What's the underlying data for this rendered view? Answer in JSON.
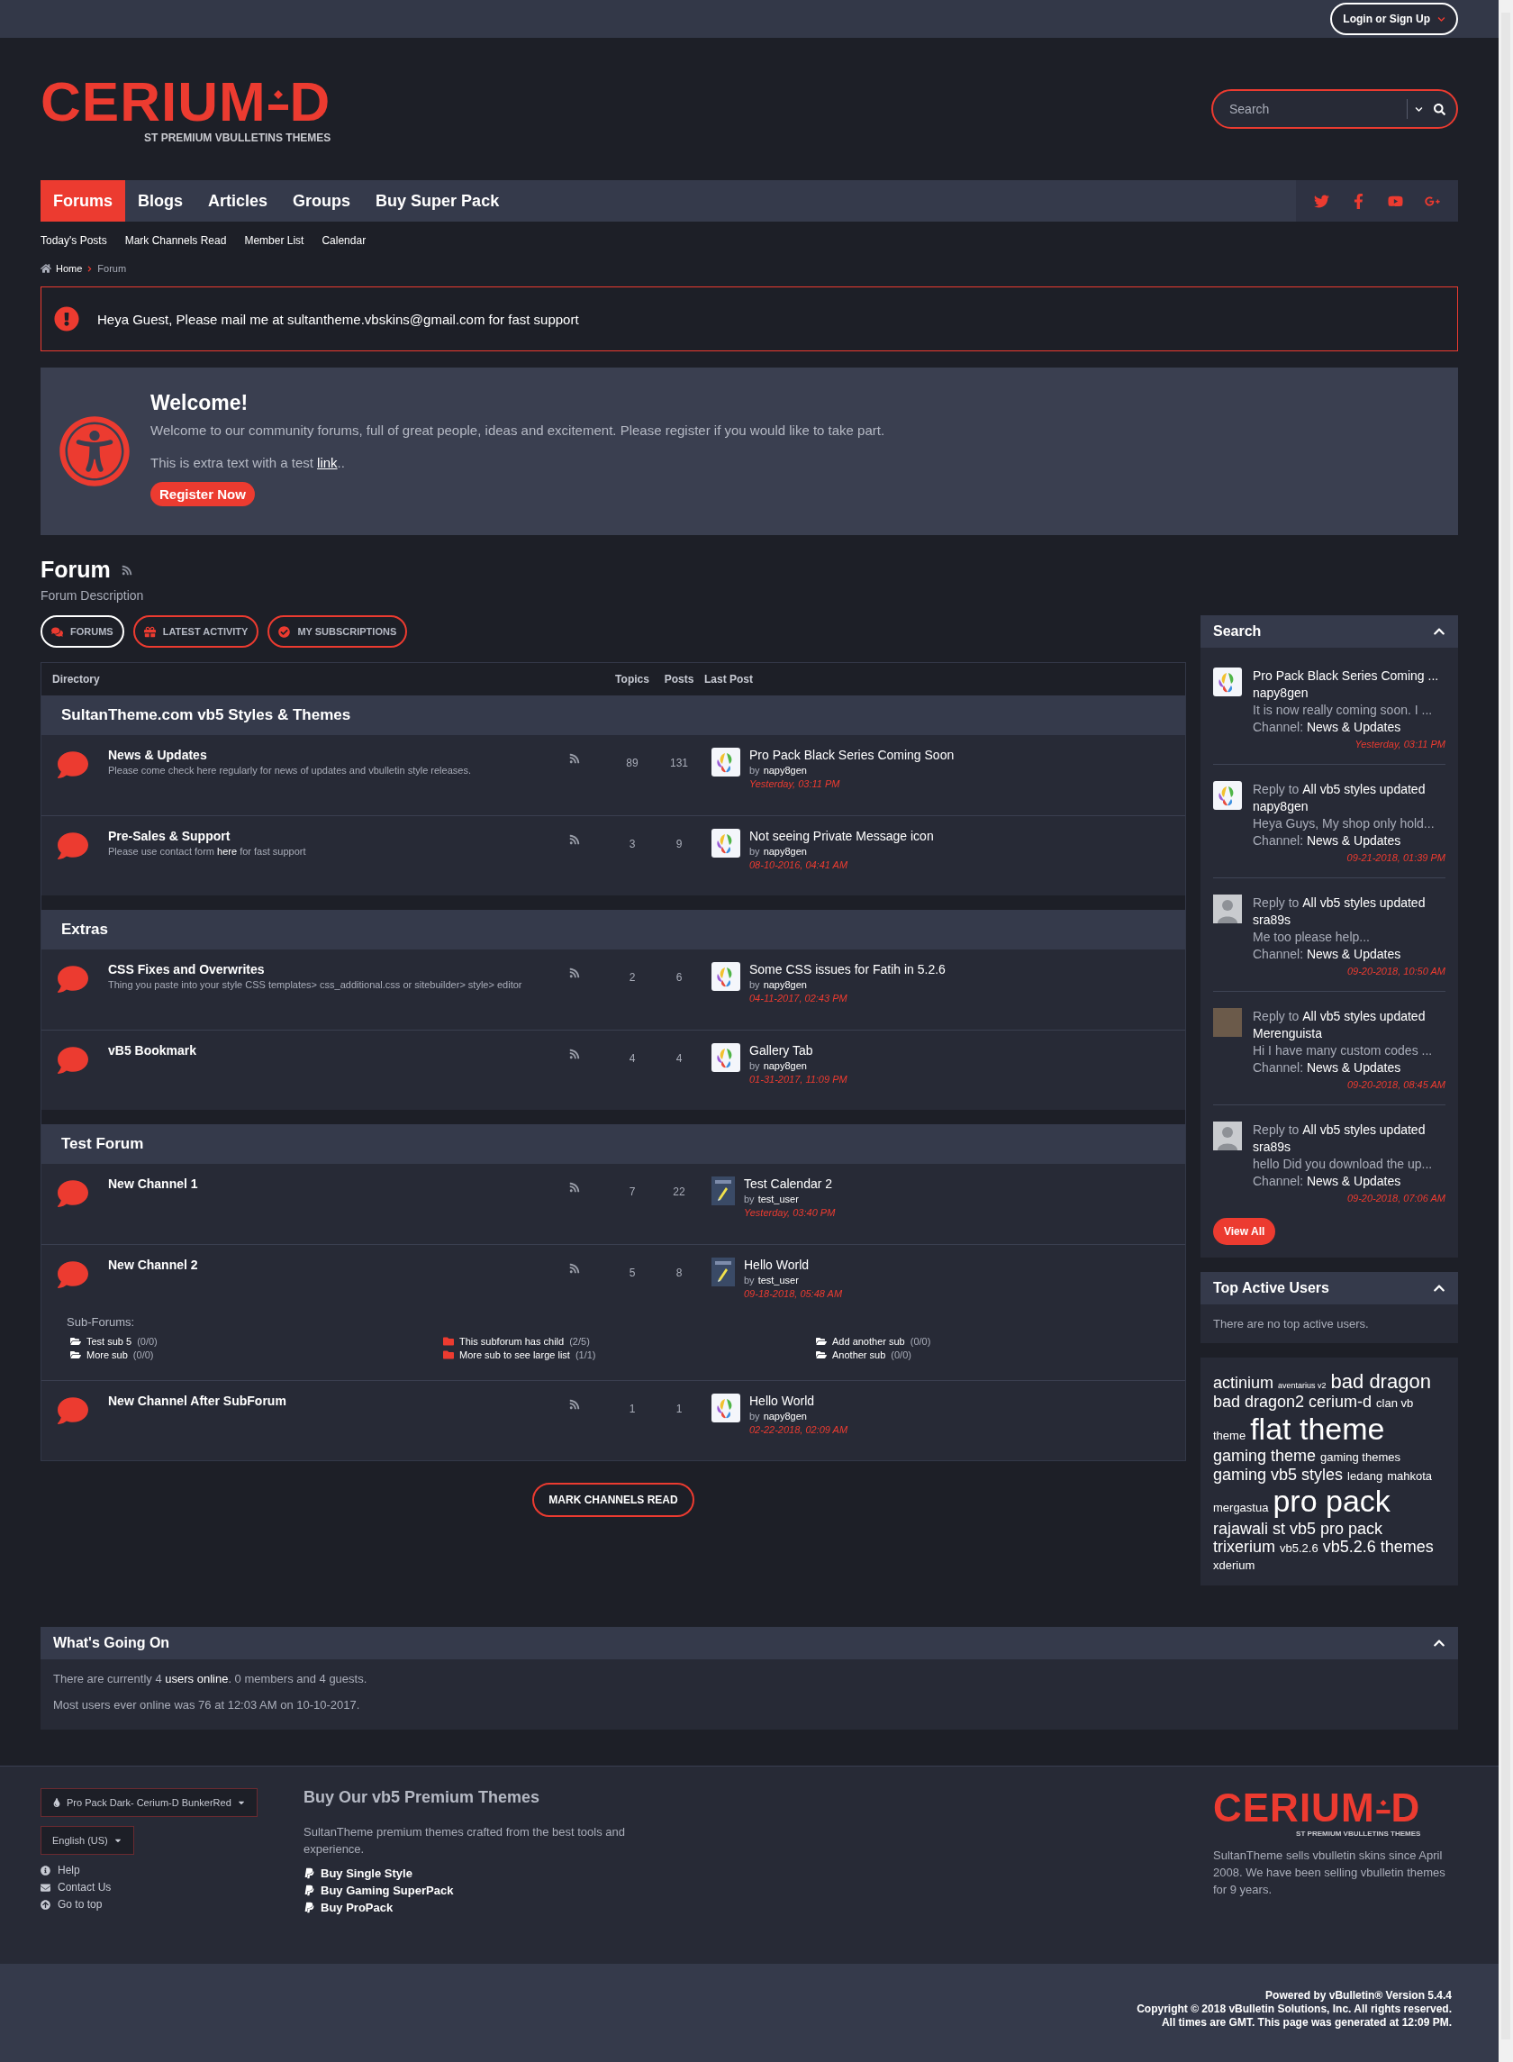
{
  "top_bar": {
    "login": "Login or Sign Up"
  },
  "logo": {
    "left": "CERIUM",
    "right": "D",
    "tagline": "ST PREMIUM VBULLETINS THEMES"
  },
  "footer_logo": {
    "left": "CERIUM",
    "right": "D",
    "tagline": "ST PREMIUM VBULLETINS THEMES"
  },
  "search": {
    "placeholder": "Search"
  },
  "nav": {
    "items": [
      {
        "label": "Forums",
        "selected": true
      },
      {
        "label": "Blogs",
        "selected": false
      },
      {
        "label": "Articles",
        "selected": false
      },
      {
        "label": "Groups",
        "selected": false
      },
      {
        "label": "Buy Super Pack",
        "selected": false
      }
    ]
  },
  "subnav": [
    "Today's Posts",
    "Mark Channels Read",
    "Member List",
    "Calendar"
  ],
  "breadcrumb": [
    "Home",
    "Forum"
  ],
  "alert": {
    "text": "Heya Guest, Please mail me at sultantheme.vbskins@gmail.com for fast support"
  },
  "welcome": {
    "title": "Welcome!",
    "text": "Welcome to our community forums, full of great people, ideas and excitement. Please register if you would like to take part.",
    "extra_before": "This is extra text with a test ",
    "extra_link": "link",
    "extra_after": "..",
    "button": "Register Now"
  },
  "forum": {
    "title": "Forum",
    "description": "Forum Description"
  },
  "forum_tabs": [
    {
      "label": "FORUMS",
      "selected": true,
      "kind": "comments"
    },
    {
      "label": "LATEST ACTIVITY",
      "selected": false,
      "kind": "gift"
    },
    {
      "label": "MY SUBSCRIPTIONS",
      "selected": false,
      "kind": "check"
    }
  ],
  "table": {
    "columns": [
      "Directory",
      "Topics",
      "Posts",
      "Last Post"
    ],
    "sections": [
      {
        "title": "SultanTheme.com vb5 Styles & Themes",
        "forums": [
          {
            "name": "News & Updates",
            "description": "Please come check here regularly for news of updates and vbulletin style releases.",
            "topics": "89",
            "posts": "131",
            "last_post": {
              "kind": "logo",
              "title": "Pro Pack Black Series Coming Soon",
              "by": "by",
              "user": "napy8gen",
              "time": "Yesterday, 03:11 PM"
            }
          },
          {
            "name": "Pre-Sales & Support",
            "description": "Please use contact form ",
            "description_link": "here",
            "description_after": " for fast support",
            "topics": "3",
            "posts": "9",
            "last_post": {
              "kind": "logo",
              "title": "Not seeing Private Message icon",
              "by": "by",
              "user": "napy8gen",
              "time": "08-10-2016, 04:41 AM"
            }
          }
        ]
      },
      {
        "title": "Extras",
        "forums": [
          {
            "name": "CSS Fixes and Overwrites",
            "description": "Thing you paste into your style CSS templates> css_additional.css or sitebuilder> style> editor",
            "topics": "2",
            "posts": "6",
            "last_post": {
              "kind": "logo",
              "title": "Some CSS issues for Fatih in 5.2.6",
              "by": "by",
              "user": "napy8gen",
              "time": "04-11-2017, 02:43 PM"
            }
          },
          {
            "name": "vB5 Bookmark",
            "topics": "4",
            "posts": "4",
            "last_post": {
              "kind": "logo",
              "title": "Gallery Tab",
              "by": "by",
              "user": "napy8gen",
              "time": "01-31-2017, 11:09 PM"
            }
          }
        ]
      },
      {
        "title": "Test Forum",
        "forums": [
          {
            "name": "New Channel 1",
            "topics": "7",
            "posts": "22",
            "last_post": {
              "kind": "calendar",
              "title": "Test Calendar 2",
              "by": "by",
              "user": "test_user",
              "time": "Yesterday, 03:40 PM"
            }
          },
          {
            "name": "New Channel 2",
            "topics": "5",
            "posts": "8",
            "last_post": {
              "kind": "calendar",
              "title": "Hello World",
              "by": "by",
              "user": "test_user",
              "time": "09-18-2018, 05:48 AM"
            },
            "subforums": {
              "label": "Sub-Forums:",
              "items": [
                {
                  "name": "Test sub 5",
                  "count": "(0/0)",
                  "kind": "open"
                },
                {
                  "name": "More sub",
                  "count": "(0/0)",
                  "kind": "open"
                },
                {
                  "name": "This subforum has child",
                  "count": "(2/5)",
                  "kind": "closed"
                },
                {
                  "name": "More sub to see large list",
                  "count": "(1/1)",
                  "kind": "closed"
                },
                {
                  "name": "Add another sub",
                  "count": "(0/0)",
                  "kind": "open"
                },
                {
                  "name": "Another sub",
                  "count": "(0/0)",
                  "kind": "open"
                }
              ]
            }
          },
          {
            "name": "New Channel After SubForum",
            "topics": "1",
            "posts": "1",
            "last_post": {
              "kind": "logo",
              "title": "Hello World",
              "by": "by",
              "user": "napy8gen",
              "time": "02-22-2018, 02:09 AM"
            }
          }
        ]
      }
    ]
  },
  "mark_read": "MARK CHANNELS READ",
  "sidebar": {
    "search": {
      "title": "Search",
      "items": [
        {
          "kind": "logo",
          "title": "Pro Pack Black Series Coming ...",
          "user": "napy8gen",
          "excerpt": "It is now really coming soon. I ...",
          "channel_label": "Channel:",
          "channel": "News & Updates",
          "time": "Yesterday, 03:11 PM"
        },
        {
          "kind": "logo",
          "prefix": "Reply to ",
          "title": "All vb5 styles updated",
          "user": "napy8gen",
          "excerpt": "Heya Guys, My shop only hold...",
          "channel_label": "Channel:",
          "channel": "News & Updates",
          "time": "09-21-2018, 01:39 PM"
        },
        {
          "kind": "silhouette",
          "prefix": "Reply to ",
          "title": "All vb5 styles updated",
          "user": "sra89s",
          "excerpt": "Me too please help...",
          "channel_label": "Channel:",
          "channel": "News & Updates",
          "time": "09-20-2018, 10:50 AM"
        },
        {
          "kind": "photo",
          "prefix": "Reply to ",
          "title": "All vb5 styles updated",
          "user": "Merenguista",
          "excerpt": "Hi I have many custom codes ...",
          "channel_label": "Channel:",
          "channel": "News & Updates",
          "time": "09-20-2018, 08:45 AM"
        },
        {
          "kind": "silhouette",
          "prefix": "Reply to ",
          "title": "All vb5 styles updated",
          "user": "sra89s",
          "excerpt": "hello Did you download the up...",
          "channel_label": "Channel:",
          "channel": "News & Updates",
          "time": "09-20-2018, 07:06 AM"
        }
      ],
      "button": "View All"
    },
    "top_users": {
      "title": "Top Active Users",
      "text": "There are no top active users."
    },
    "tags": [
      {
        "label": "actinium",
        "kind": "md"
      },
      {
        "label": "aventarius v2",
        "kind": "xs"
      },
      {
        "label": "bad dragon",
        "kind": "lg"
      },
      {
        "label": "bad dragon2",
        "kind": "md"
      },
      {
        "label": "cerium-d",
        "kind": "md"
      },
      {
        "label": "clan vb",
        "kind": "sm"
      },
      {
        "label": "theme",
        "kind": "sm"
      },
      {
        "label": "flat theme",
        "kind": "xl"
      },
      {
        "label": "gaming theme",
        "kind": "md"
      },
      {
        "label": "gaming themes",
        "kind": "sm"
      },
      {
        "label": "gaming vb5 styles",
        "kind": "md"
      },
      {
        "label": "ledang",
        "kind": "sm"
      },
      {
        "label": "mahkota",
        "kind": "sm"
      },
      {
        "label": "mergastua",
        "kind": "sm"
      },
      {
        "label": "pro pack",
        "kind": "xl"
      },
      {
        "label": "rajawali",
        "kind": "md"
      },
      {
        "label": "st vb5 pro pack",
        "kind": "md"
      },
      {
        "label": "trixerium",
        "kind": "md"
      },
      {
        "label": "vb5.2.6",
        "kind": "sm"
      },
      {
        "label": "vb5.2.6 themes",
        "kind": "md"
      },
      {
        "label": "xderium",
        "kind": "sm"
      }
    ]
  },
  "whats_going_on": {
    "title": "What's Going On",
    "online_before": "There are currently 4 ",
    "online_link": "users online",
    "online_after": ". 0 members and 4 guests.",
    "record": "Most users ever online was 76 at 12:03 AM on 10-10-2017."
  },
  "footer": {
    "style_select": "Pro Pack Dark- Cerium-D BunkerRed",
    "language_select": "English (US)",
    "links": [
      {
        "label": "Help",
        "kind": "help"
      },
      {
        "label": "Contact Us",
        "kind": "contact"
      },
      {
        "label": "Go to top",
        "kind": "top"
      }
    ],
    "promo": {
      "title": "Buy Our vb5 Premium Themes",
      "text": "SultanTheme premium themes crafted from the best tools and experience.",
      "links": [
        "Buy Single Style",
        "Buy Gaming SuperPack",
        "Buy ProPack"
      ]
    },
    "about": "SultanTheme sells vbulletin skins since April 2008. We have been selling vbulletin themes for 9 years."
  },
  "bottom_bar": [
    "Powered by vBulletin® Version 5.4.4",
    "Copyright © 2018 vBulletin Solutions, Inc. All rights reserved.",
    "All times are GMT. This page was generated at 12:09 PM."
  ]
}
